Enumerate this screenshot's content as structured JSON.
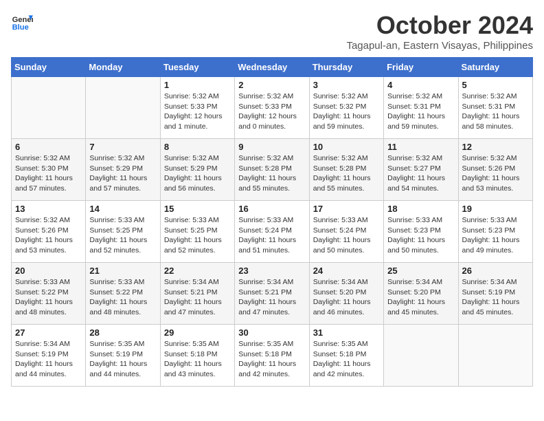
{
  "logo": {
    "line1": "General",
    "line2": "Blue"
  },
  "title": "October 2024",
  "subtitle": "Tagapul-an, Eastern Visayas, Philippines",
  "header": {
    "days": [
      "Sunday",
      "Monday",
      "Tuesday",
      "Wednesday",
      "Thursday",
      "Friday",
      "Saturday"
    ]
  },
  "weeks": [
    [
      {
        "day": "",
        "info": ""
      },
      {
        "day": "",
        "info": ""
      },
      {
        "day": "1",
        "info": "Sunrise: 5:32 AM\nSunset: 5:33 PM\nDaylight: 12 hours\nand 1 minute."
      },
      {
        "day": "2",
        "info": "Sunrise: 5:32 AM\nSunset: 5:33 PM\nDaylight: 12 hours\nand 0 minutes."
      },
      {
        "day": "3",
        "info": "Sunrise: 5:32 AM\nSunset: 5:32 PM\nDaylight: 11 hours\nand 59 minutes."
      },
      {
        "day": "4",
        "info": "Sunrise: 5:32 AM\nSunset: 5:31 PM\nDaylight: 11 hours\nand 59 minutes."
      },
      {
        "day": "5",
        "info": "Sunrise: 5:32 AM\nSunset: 5:31 PM\nDaylight: 11 hours\nand 58 minutes."
      }
    ],
    [
      {
        "day": "6",
        "info": "Sunrise: 5:32 AM\nSunset: 5:30 PM\nDaylight: 11 hours\nand 57 minutes."
      },
      {
        "day": "7",
        "info": "Sunrise: 5:32 AM\nSunset: 5:29 PM\nDaylight: 11 hours\nand 57 minutes."
      },
      {
        "day": "8",
        "info": "Sunrise: 5:32 AM\nSunset: 5:29 PM\nDaylight: 11 hours\nand 56 minutes."
      },
      {
        "day": "9",
        "info": "Sunrise: 5:32 AM\nSunset: 5:28 PM\nDaylight: 11 hours\nand 55 minutes."
      },
      {
        "day": "10",
        "info": "Sunrise: 5:32 AM\nSunset: 5:28 PM\nDaylight: 11 hours\nand 55 minutes."
      },
      {
        "day": "11",
        "info": "Sunrise: 5:32 AM\nSunset: 5:27 PM\nDaylight: 11 hours\nand 54 minutes."
      },
      {
        "day": "12",
        "info": "Sunrise: 5:32 AM\nSunset: 5:26 PM\nDaylight: 11 hours\nand 53 minutes."
      }
    ],
    [
      {
        "day": "13",
        "info": "Sunrise: 5:32 AM\nSunset: 5:26 PM\nDaylight: 11 hours\nand 53 minutes."
      },
      {
        "day": "14",
        "info": "Sunrise: 5:33 AM\nSunset: 5:25 PM\nDaylight: 11 hours\nand 52 minutes."
      },
      {
        "day": "15",
        "info": "Sunrise: 5:33 AM\nSunset: 5:25 PM\nDaylight: 11 hours\nand 52 minutes."
      },
      {
        "day": "16",
        "info": "Sunrise: 5:33 AM\nSunset: 5:24 PM\nDaylight: 11 hours\nand 51 minutes."
      },
      {
        "day": "17",
        "info": "Sunrise: 5:33 AM\nSunset: 5:24 PM\nDaylight: 11 hours\nand 50 minutes."
      },
      {
        "day": "18",
        "info": "Sunrise: 5:33 AM\nSunset: 5:23 PM\nDaylight: 11 hours\nand 50 minutes."
      },
      {
        "day": "19",
        "info": "Sunrise: 5:33 AM\nSunset: 5:23 PM\nDaylight: 11 hours\nand 49 minutes."
      }
    ],
    [
      {
        "day": "20",
        "info": "Sunrise: 5:33 AM\nSunset: 5:22 PM\nDaylight: 11 hours\nand 48 minutes."
      },
      {
        "day": "21",
        "info": "Sunrise: 5:33 AM\nSunset: 5:22 PM\nDaylight: 11 hours\nand 48 minutes."
      },
      {
        "day": "22",
        "info": "Sunrise: 5:34 AM\nSunset: 5:21 PM\nDaylight: 11 hours\nand 47 minutes."
      },
      {
        "day": "23",
        "info": "Sunrise: 5:34 AM\nSunset: 5:21 PM\nDaylight: 11 hours\nand 47 minutes."
      },
      {
        "day": "24",
        "info": "Sunrise: 5:34 AM\nSunset: 5:20 PM\nDaylight: 11 hours\nand 46 minutes."
      },
      {
        "day": "25",
        "info": "Sunrise: 5:34 AM\nSunset: 5:20 PM\nDaylight: 11 hours\nand 45 minutes."
      },
      {
        "day": "26",
        "info": "Sunrise: 5:34 AM\nSunset: 5:19 PM\nDaylight: 11 hours\nand 45 minutes."
      }
    ],
    [
      {
        "day": "27",
        "info": "Sunrise: 5:34 AM\nSunset: 5:19 PM\nDaylight: 11 hours\nand 44 minutes."
      },
      {
        "day": "28",
        "info": "Sunrise: 5:35 AM\nSunset: 5:19 PM\nDaylight: 11 hours\nand 44 minutes."
      },
      {
        "day": "29",
        "info": "Sunrise: 5:35 AM\nSunset: 5:18 PM\nDaylight: 11 hours\nand 43 minutes."
      },
      {
        "day": "30",
        "info": "Sunrise: 5:35 AM\nSunset: 5:18 PM\nDaylight: 11 hours\nand 42 minutes."
      },
      {
        "day": "31",
        "info": "Sunrise: 5:35 AM\nSunset: 5:18 PM\nDaylight: 11 hours\nand 42 minutes."
      },
      {
        "day": "",
        "info": ""
      },
      {
        "day": "",
        "info": ""
      }
    ]
  ]
}
